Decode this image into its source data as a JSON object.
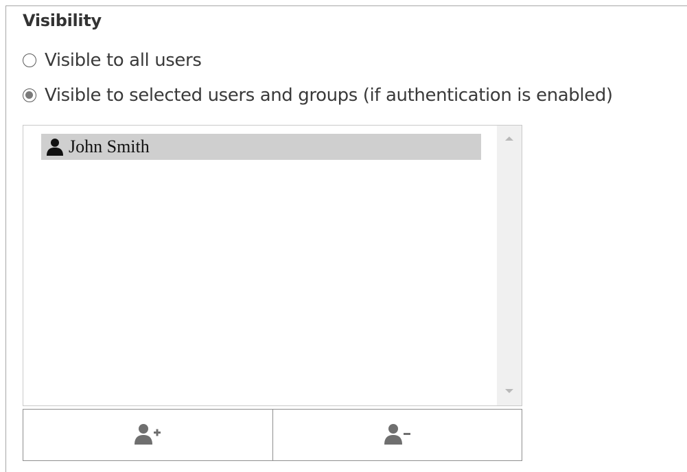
{
  "visibility": {
    "title": "Visibility",
    "options": [
      {
        "label": "Visible to all users",
        "selected": false
      },
      {
        "label": "Visible to selected users and groups (if authentication is enabled)",
        "selected": true
      }
    ]
  },
  "members": {
    "items": [
      {
        "label": "John Smith",
        "icon": "user-icon",
        "selected": true
      }
    ]
  },
  "actions": {
    "add_icon": "add-user-icon",
    "remove_icon": "remove-user-icon"
  },
  "colors": {
    "selected_row": "#cfcfcf",
    "icon_gray": "#6f6f6f",
    "border": "#8e8e8e"
  }
}
